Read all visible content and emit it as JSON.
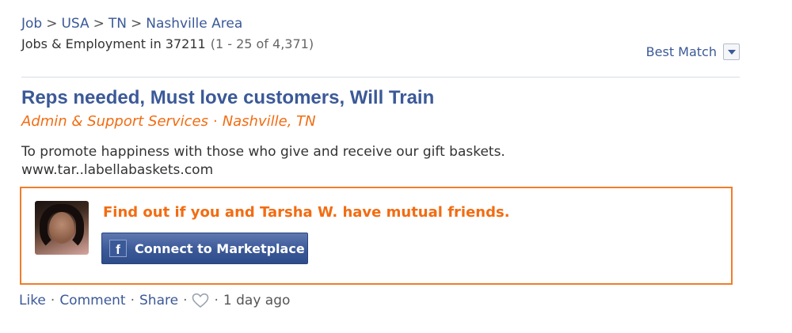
{
  "breadcrumb": {
    "items": [
      "Job",
      "USA",
      "TN",
      "Nashville Area"
    ],
    "separator": ">"
  },
  "results": {
    "heading": "Jobs & Employment in 37211",
    "count": "(1 - 25 of 4,371)",
    "sort_label": "Best Match"
  },
  "listing": {
    "title": "Reps needed, Must love customers, Will Train",
    "category": "Admin & Support Services",
    "location": "Nashville, TN",
    "description": "To promote happiness with those who give and receive our gift baskets.",
    "url": "www.tar..labellabaskets.com"
  },
  "promo": {
    "text": "Find out if you and Tarsha W. have mutual friends.",
    "button_label": "Connect to Marketplace",
    "button_icon": "facebook-icon"
  },
  "actions": {
    "like": "Like",
    "comment": "Comment",
    "share": "Share",
    "time": "1 day ago",
    "separator": "·"
  },
  "colors": {
    "link": "#3b5998",
    "accent": "#f26c12",
    "border": "#f07d2a"
  }
}
